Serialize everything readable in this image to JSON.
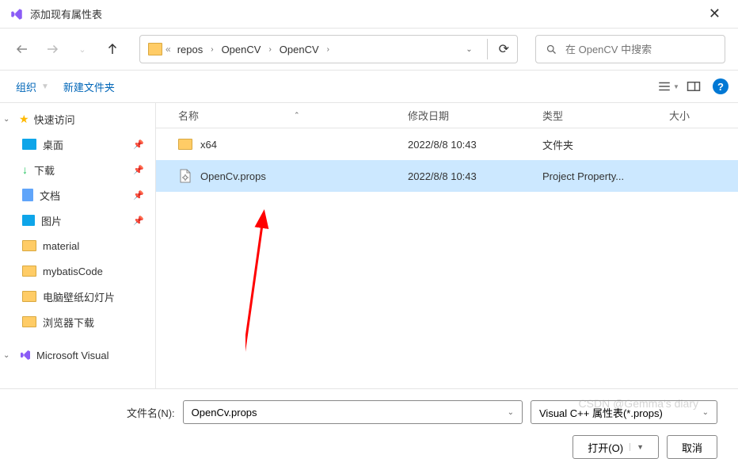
{
  "window": {
    "title": "添加现有属性表"
  },
  "breadcrumb": {
    "root": "repos",
    "p1": "OpenCV",
    "p2": "OpenCV"
  },
  "search": {
    "placeholder": "在 OpenCV 中搜索"
  },
  "toolbar": {
    "organize": "组织",
    "newfolder": "新建文件夹"
  },
  "sidebar": {
    "quick": "快速访问",
    "desktop": "桌面",
    "downloads": "下载",
    "documents": "文档",
    "pictures": "图片",
    "material": "material",
    "mybatis": "mybatisCode",
    "wallpaper": "电脑壁纸幻灯片",
    "browserdl": "浏览器下载",
    "msvs": "Microsoft Visual"
  },
  "columns": {
    "name": "名称",
    "date": "修改日期",
    "type": "类型",
    "size": "大小"
  },
  "files": {
    "r0": {
      "name": "x64",
      "date": "2022/8/8 10:43",
      "type": "文件夹"
    },
    "r1": {
      "name": "OpenCv.props",
      "date": "2022/8/8 10:43",
      "type": "Project Property..."
    }
  },
  "bottom": {
    "filename_label": "文件名(N):",
    "filename_value": "OpenCv.props",
    "filter": "Visual C++ 属性表(*.props)",
    "open": "打开(O)",
    "cancel": "取消"
  },
  "watermark": "CSDN @Gemma's diary",
  "chart_data": null
}
